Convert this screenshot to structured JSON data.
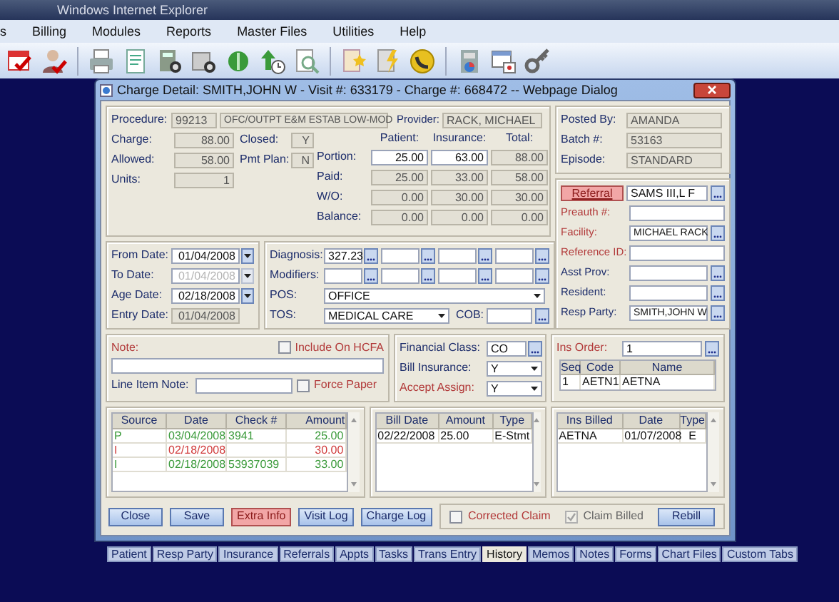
{
  "browser": {
    "title": "Windows Internet Explorer"
  },
  "menu": [
    {
      "label": "s"
    },
    {
      "label": "Billing"
    },
    {
      "label": "Modules"
    },
    {
      "label": "Reports"
    },
    {
      "label": "Master Files"
    },
    {
      "label": "Utilities"
    },
    {
      "label": "Help"
    }
  ],
  "dialog": {
    "title": "Charge Detail: SMITH,JOHN W - Visit #: 633179 - Charge #: 668472 -- Webpage Dialog",
    "procedure": {
      "label": "Procedure:",
      "code": "99213",
      "description": "OFC/OUTPT E&M ESTAB LOW-MOD"
    },
    "provider": {
      "label": "Provider:",
      "value": "RACK, MICHAEL"
    },
    "charge_fields": [
      {
        "label": "Charge:",
        "value": "88.00",
        "flag_label": "Closed:",
        "flag_value": "Y"
      },
      {
        "label": "Allowed:",
        "value": "58.00",
        "flag_label": "Pmt Plan:",
        "flag_value": "N"
      },
      {
        "label": "Units:",
        "value": "1"
      }
    ],
    "amount_columns": [
      "Patient:",
      "Insurance:",
      "Total:"
    ],
    "amount_rows": [
      {
        "label": "Portion:",
        "editable": true,
        "values": [
          "25.00",
          "63.00",
          "88.00"
        ]
      },
      {
        "label": "Paid:",
        "editable": false,
        "values": [
          "25.00",
          "33.00",
          "58.00"
        ]
      },
      {
        "label": "W/O:",
        "editable": false,
        "values": [
          "0.00",
          "30.00",
          "30.00"
        ]
      },
      {
        "label": "Balance:",
        "editable": false,
        "values": [
          "0.00",
          "0.00",
          "0.00"
        ]
      }
    ],
    "summary": [
      {
        "label": "Posted By:",
        "value": "AMANDA"
      },
      {
        "label": "Batch #:",
        "value": "53163"
      },
      {
        "label": "Episode:",
        "value": "STANDARD"
      }
    ],
    "referral": {
      "button": "Referral",
      "value": "SAMS III,L F"
    },
    "referral_fields": [
      {
        "label": "Preauth #:",
        "required": true,
        "lookup": false
      },
      {
        "label": "Facility:",
        "value": "MICHAEL RACK",
        "required": true,
        "lookup": true
      },
      {
        "label": "Reference ID:",
        "required": true,
        "lookup": false
      },
      {
        "label": "Asst Prov:",
        "required": false,
        "lookup": true
      },
      {
        "label": "Resident:",
        "required": false,
        "lookup": true
      },
      {
        "label": "Resp Party:",
        "value": "SMITH,JOHN W",
        "required": false,
        "lookup": true
      }
    ],
    "dates": [
      {
        "label": "From Date:",
        "value": "01/04/2008",
        "kind": "date",
        "disabled": false
      },
      {
        "label": "To Date:",
        "value": "01/04/2008",
        "kind": "date",
        "disabled": true
      },
      {
        "label": "Age Date:",
        "value": "02/18/2008",
        "kind": "date",
        "disabled": false
      },
      {
        "label": "Entry Date:",
        "value": "01/04/2008",
        "kind": "readonly",
        "disabled": false
      }
    ],
    "diagnosis": {
      "label": "Diagnosis:",
      "codes": [
        "327.23"
      ]
    },
    "modifiers": {
      "label": "Modifiers:"
    },
    "pos": {
      "label": "POS:",
      "value": "OFFICE"
    },
    "tos": {
      "label": "TOS:",
      "value": "MEDICAL CARE"
    },
    "cob": {
      "label": "COB:"
    },
    "note": {
      "label": "Note:",
      "line_item_label": "Line Item Note:"
    },
    "note_checks": [
      {
        "label": "Include On HCFA",
        "checked": false
      },
      {
        "label": "Force Paper",
        "checked": false
      }
    ],
    "billing": [
      {
        "label": "Financial Class:",
        "value": "CO",
        "kind": "lookup",
        "required": false
      },
      {
        "label": "Bill Insurance:",
        "value": "Y",
        "kind": "dropdown",
        "required": false
      },
      {
        "label": "Accept Assign:",
        "value": "Y",
        "kind": "dropdown",
        "required": true
      }
    ],
    "ins_order": {
      "label": "Ins Order:",
      "value": "1",
      "columns": [
        "Seq",
        "Code",
        "Name"
      ],
      "rows": [
        [
          "1",
          "AETN1",
          "AETNA"
        ]
      ]
    },
    "payments": {
      "columns": [
        "Source",
        "Date",
        "Check #",
        "Amount"
      ],
      "rows": [
        {
          "cells": [
            "P",
            "03/04/2008",
            "3941",
            "25.00"
          ],
          "color": "#3a9a3a"
        },
        {
          "cells": [
            "I",
            "02/18/2008",
            "",
            "30.00"
          ],
          "color": "#d03a3a"
        },
        {
          "cells": [
            "I",
            "02/18/2008",
            "53937039",
            "33.00"
          ],
          "color": "#3a9a3a"
        }
      ]
    },
    "bills": {
      "columns": [
        "Bill Date",
        "Amount",
        "Type"
      ],
      "rows": [
        [
          "02/22/2008",
          "25.00",
          "E-Stmt"
        ]
      ]
    },
    "ins_billed": {
      "columns": [
        "Ins Billed",
        "Date",
        "Type"
      ],
      "rows": [
        [
          "AETNA",
          "01/07/2008",
          "E"
        ]
      ]
    },
    "buttons": [
      {
        "label": "Close",
        "kind": "normal"
      },
      {
        "label": "Save",
        "kind": "normal"
      },
      {
        "label": "Extra Info",
        "kind": "alert"
      },
      {
        "label": "Visit Log",
        "kind": "normal"
      },
      {
        "label": "Charge Log",
        "kind": "normal"
      }
    ],
    "claim_checks": [
      {
        "label": "Corrected Claim",
        "checked": false,
        "disabled": false
      },
      {
        "label": "Claim Billed",
        "checked": true,
        "disabled": true
      }
    ],
    "rebill": "Rebill"
  },
  "tabs": [
    {
      "label": "Patient",
      "selected": false
    },
    {
      "label": "Resp Party",
      "selected": false
    },
    {
      "label": "Insurance",
      "selected": false
    },
    {
      "label": "Referrals",
      "selected": false
    },
    {
      "label": "Appts",
      "selected": false
    },
    {
      "label": "Tasks",
      "selected": false
    },
    {
      "label": "Trans Entry",
      "selected": false
    },
    {
      "label": "History",
      "selected": true
    },
    {
      "label": "Memos",
      "selected": false
    },
    {
      "label": "Notes",
      "selected": false
    },
    {
      "label": "Forms",
      "selected": false
    },
    {
      "label": "Chart Files",
      "selected": false
    },
    {
      "label": "Custom Tabs",
      "selected": false
    }
  ]
}
